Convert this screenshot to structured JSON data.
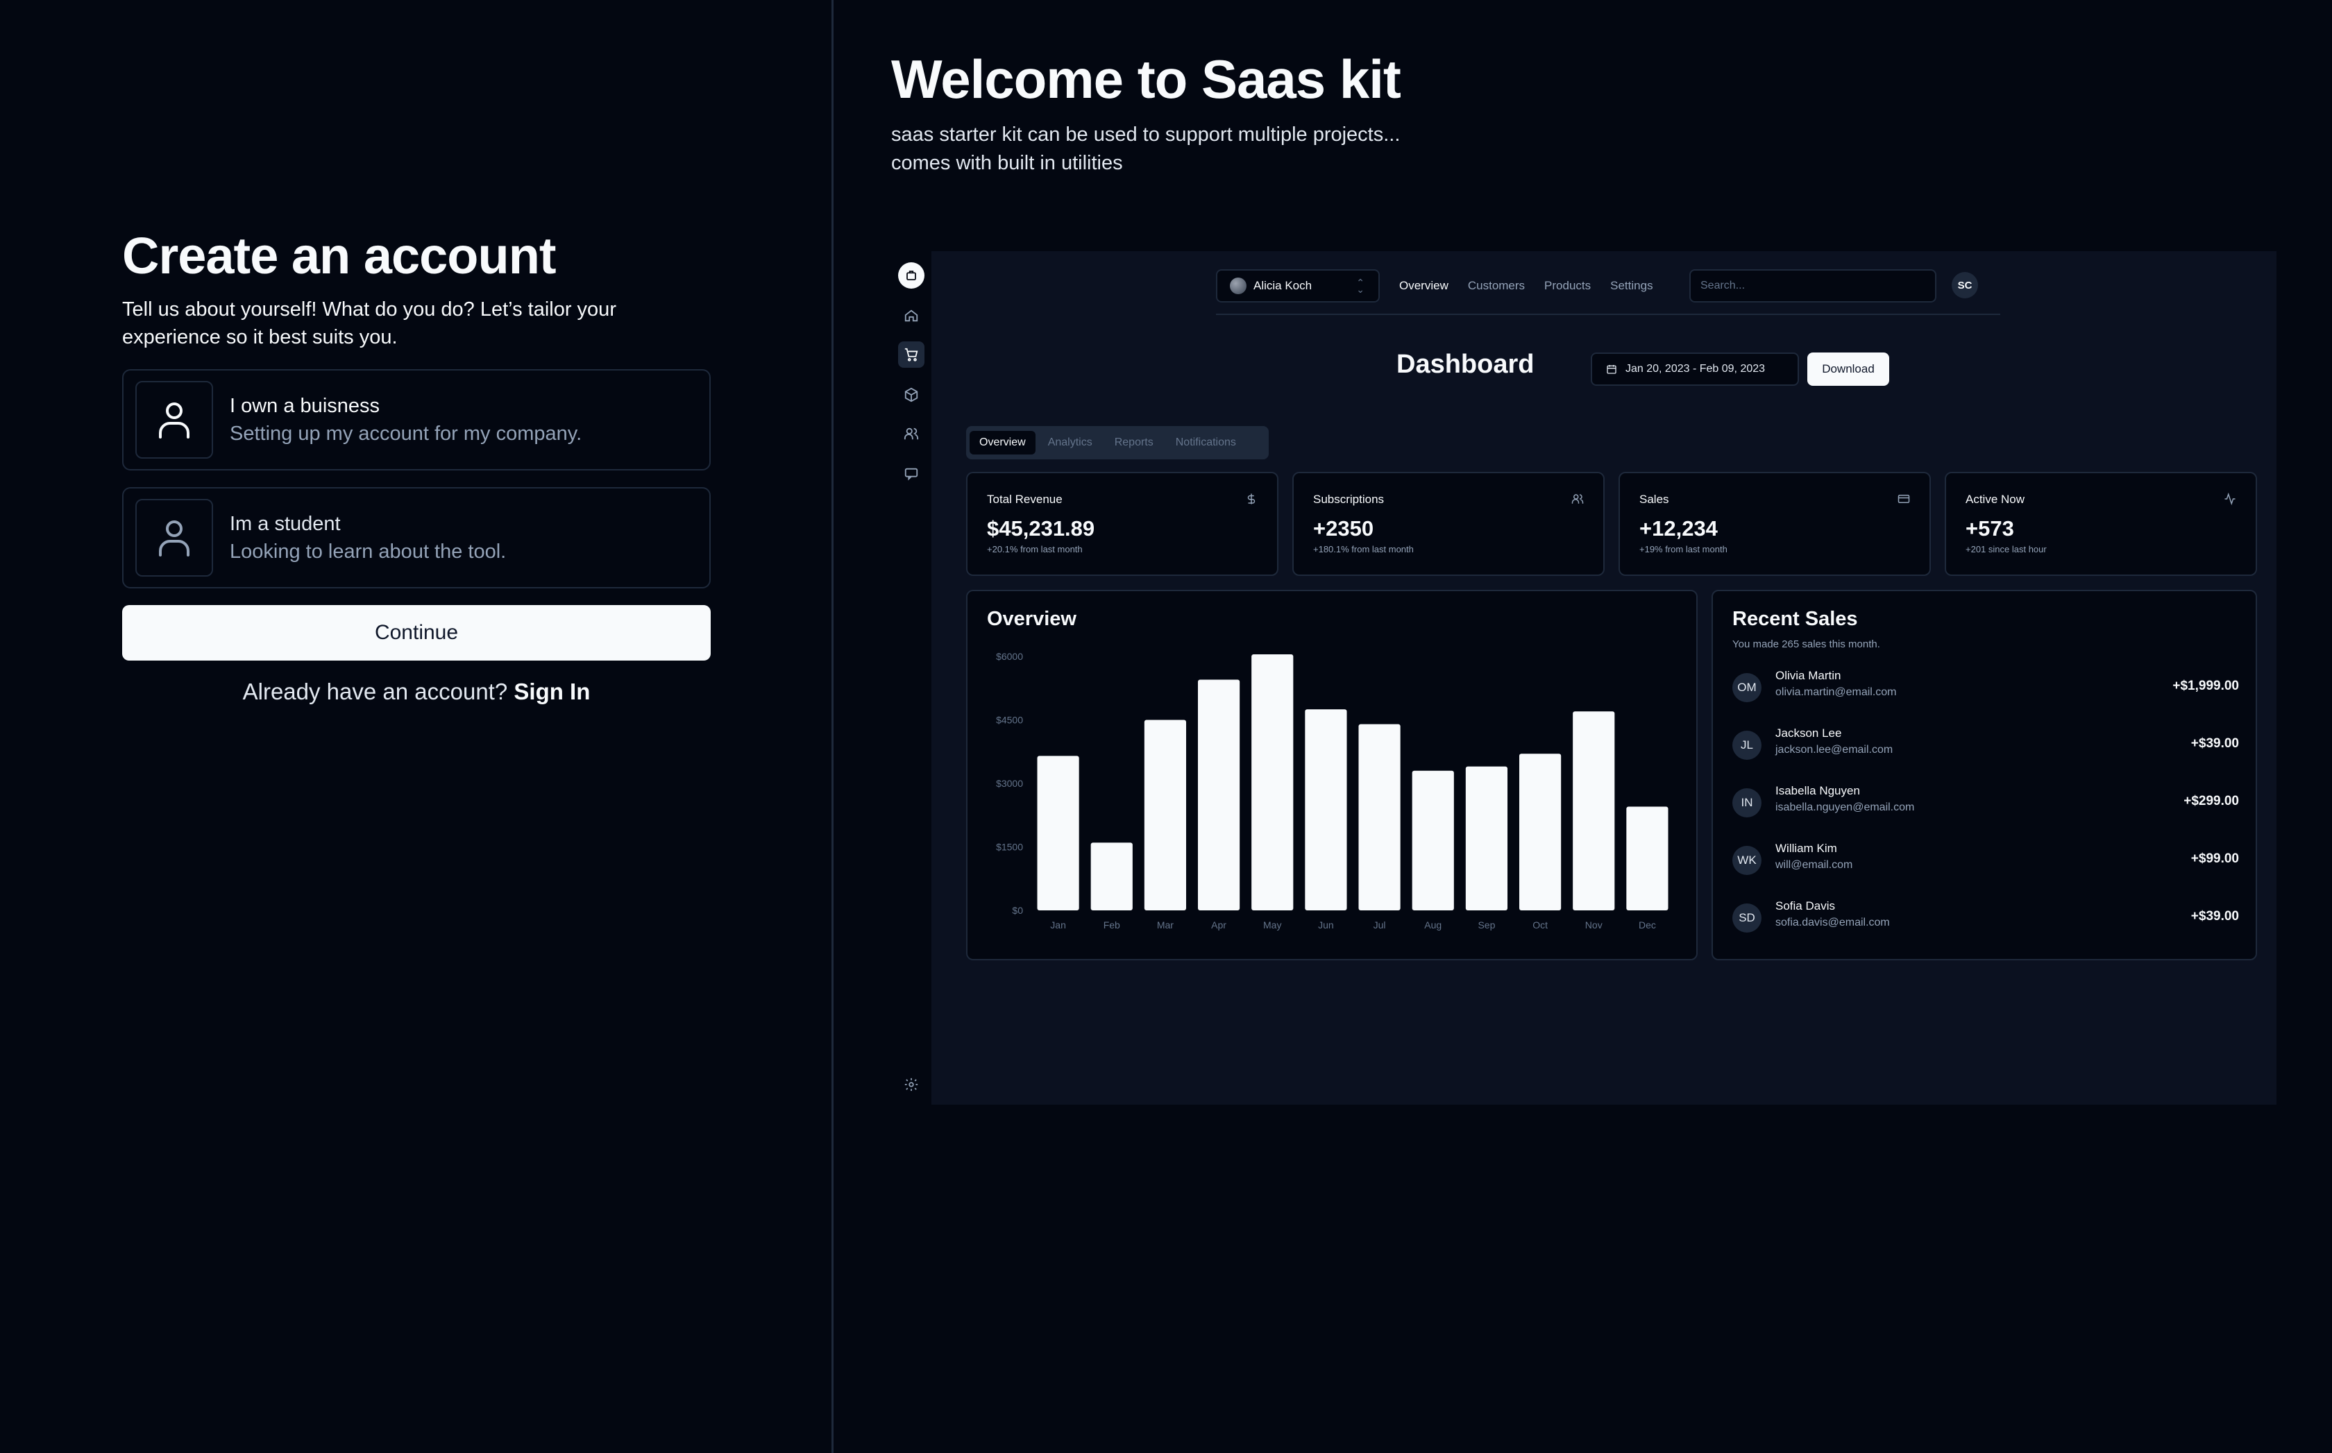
{
  "signup": {
    "title": "Create an account",
    "description": "Tell us about yourself! What do you do? Let’s tailor your experience so it best suits you.",
    "options": [
      {
        "title": "I own a buisness",
        "subtitle": "Setting up my account for my company.",
        "icon": "user-icon"
      },
      {
        "title": "Im a student",
        "subtitle": "Looking to learn about the tool.",
        "icon": "user-icon"
      }
    ],
    "continue_label": "Continue",
    "signin_prompt": "Already have an account?",
    "signin_link": "Sign In"
  },
  "hero": {
    "title": "Welcome to Saas kit",
    "subtitle_line1": "saas starter kit can be used to support multiple projects...",
    "subtitle_line2": "comes with built in utilities"
  },
  "dashboard": {
    "rail_icons": [
      "logo-icon",
      "home-icon",
      "cart-icon",
      "package-icon",
      "users-icon",
      "message-icon",
      "settings-icon"
    ],
    "team": "Alicia Koch",
    "nav": [
      "Overview",
      "Customers",
      "Products",
      "Settings"
    ],
    "search_placeholder": "Search...",
    "user_initials": "SC",
    "title": "Dashboard",
    "date_range": "Jan 20, 2023 - Feb 09, 2023",
    "download_label": "Download",
    "tabs": [
      "Overview",
      "Analytics",
      "Reports",
      "Notifications"
    ],
    "stats": [
      {
        "label": "Total Revenue",
        "value": "$45,231.89",
        "note": "+20.1% from last month",
        "icon": "dollar-icon"
      },
      {
        "label": "Subscriptions",
        "value": "+2350",
        "note": "+180.1% from last month",
        "icon": "users-icon"
      },
      {
        "label": "Sales",
        "value": "+12,234",
        "note": "+19% from last month",
        "icon": "credit-card-icon"
      },
      {
        "label": "Active Now",
        "value": "+573",
        "note": "+201 since last hour",
        "icon": "activity-icon"
      }
    ],
    "overview_title": "Overview",
    "recent_sales": {
      "title": "Recent Sales",
      "subtitle": "You made 265 sales this month.",
      "rows": [
        {
          "initials": "OM",
          "name": "Olivia Martin",
          "email": "olivia.martin@email.com",
          "amount": "+$1,999.00"
        },
        {
          "initials": "JL",
          "name": "Jackson Lee",
          "email": "jackson.lee@email.com",
          "amount": "+$39.00"
        },
        {
          "initials": "IN",
          "name": "Isabella Nguyen",
          "email": "isabella.nguyen@email.com",
          "amount": "+$299.00"
        },
        {
          "initials": "WK",
          "name": "William Kim",
          "email": "will@email.com",
          "amount": "+$99.00"
        },
        {
          "initials": "SD",
          "name": "Sofia Davis",
          "email": "sofia.davis@email.com",
          "amount": "+$39.00"
        }
      ]
    }
  },
  "chart_data": {
    "type": "bar",
    "title": "Overview",
    "categories": [
      "Jan",
      "Feb",
      "Mar",
      "Apr",
      "May",
      "Jun",
      "Jul",
      "Aug",
      "Sep",
      "Oct",
      "Nov",
      "Dec"
    ],
    "values": [
      3650,
      1600,
      4500,
      5450,
      6050,
      4750,
      4400,
      3300,
      3400,
      3700,
      4700,
      2450
    ],
    "yticks": [
      "$0",
      "$1500",
      "$3000",
      "$4500",
      "$6000"
    ],
    "ylim": [
      0,
      6000
    ],
    "bar_color": "#f8fafc",
    "grid": false
  },
  "colors": {
    "background": "#030711",
    "panel": "#0b1120",
    "border": "#1e293b",
    "muted_text": "#94a3b8",
    "primary": "#f8fafc"
  }
}
